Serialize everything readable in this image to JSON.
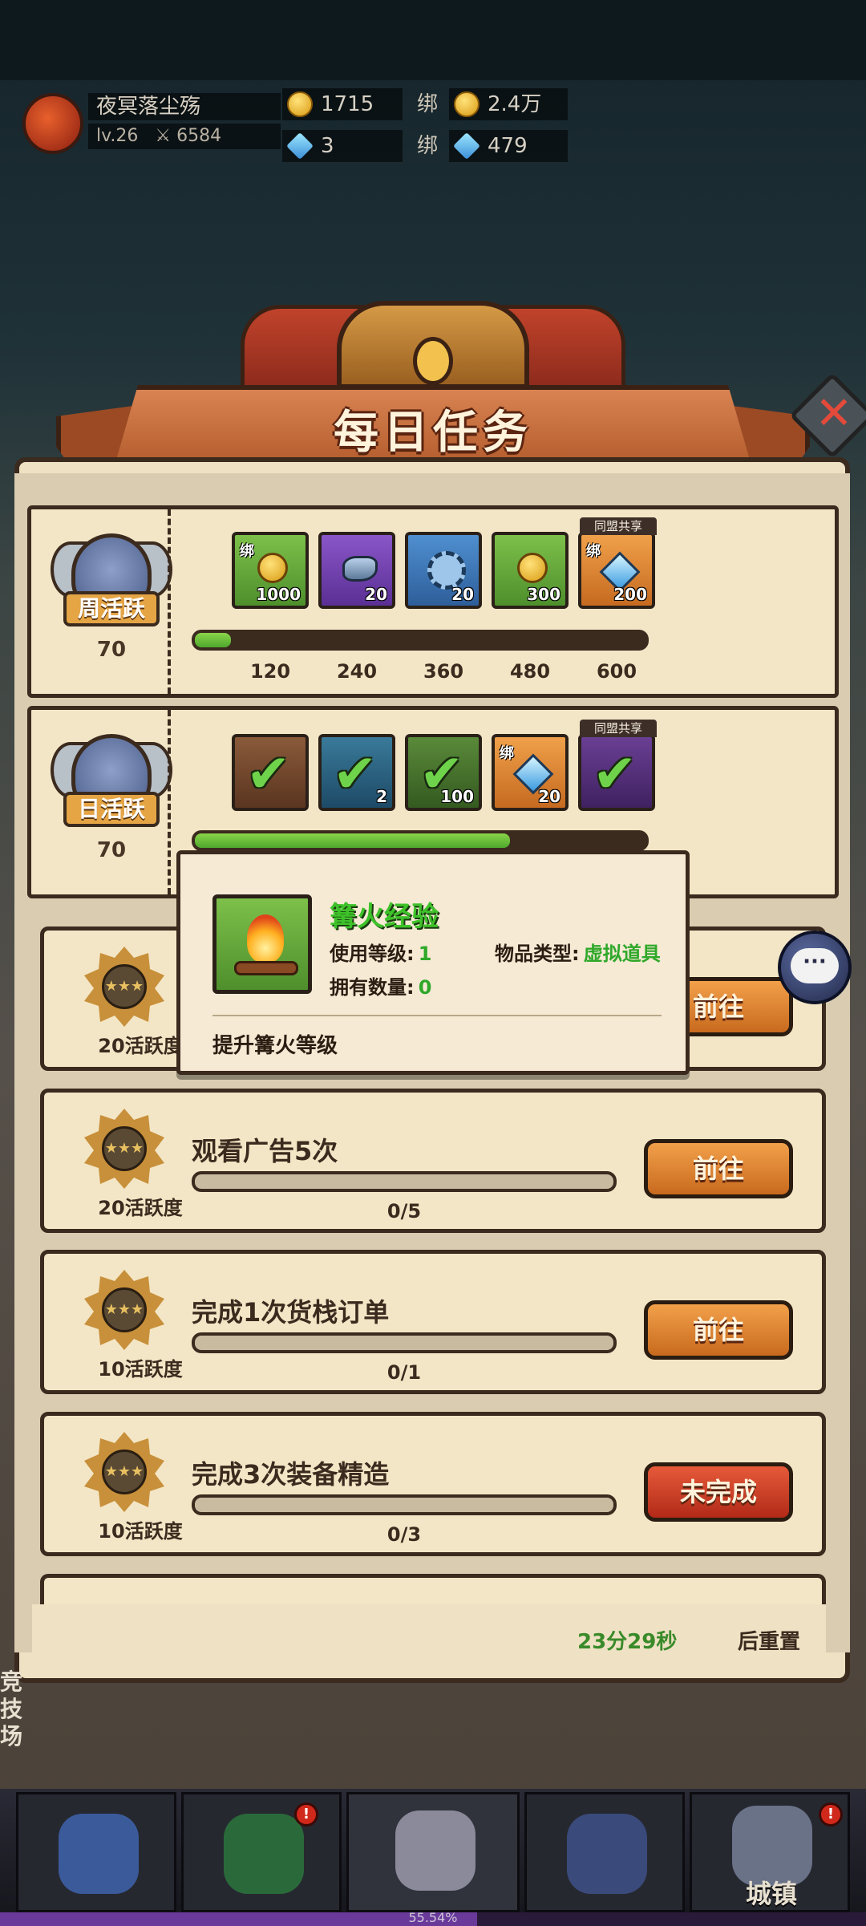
{
  "player": {
    "name": "夜冥落尘殇",
    "level": "lv.26",
    "power": "6584"
  },
  "currency": {
    "coin": "1715",
    "bound_coin": "2.4万",
    "gem": "3",
    "bound_gem": "479",
    "bind_label": "绑"
  },
  "title": "每日任务",
  "weekly": {
    "label": "周活跃",
    "value": "70",
    "progress_fraction": 0.08,
    "milestones": [
      "120",
      "240",
      "360",
      "480",
      "600"
    ],
    "rewards": [
      {
        "icon": "gold-coin-icon",
        "qty": "1000",
        "bind": "绑"
      },
      {
        "icon": "stone-icon",
        "qty": "20"
      },
      {
        "icon": "gear-token-icon",
        "qty": "20"
      },
      {
        "icon": "gold-coin-icon",
        "qty": "300"
      },
      {
        "icon": "diamond-icon",
        "qty": "200",
        "bind": "绑",
        "shared": "同盟共享"
      }
    ]
  },
  "daily": {
    "label": "日活跃",
    "value": "70",
    "progress_fraction": 0.7,
    "rewards": [
      {
        "icon": "check-icon"
      },
      {
        "icon": "check-icon",
        "qty": "2"
      },
      {
        "icon": "check-icon",
        "qty": "100"
      },
      {
        "icon": "diamond-icon",
        "qty": "20",
        "bind": "绑"
      },
      {
        "icon": "check-icon",
        "shared": "同盟共享"
      }
    ]
  },
  "tooltip": {
    "name": "篝火经验",
    "use_level_label": "使用等级:",
    "use_level": "1",
    "owned_label": "拥有数量:",
    "owned": "0",
    "type_label": "物品类型:",
    "type": "虚拟道具",
    "description": "提升篝火等级"
  },
  "tasks": [
    {
      "title": "",
      "points": "20活跃度",
      "progress": "",
      "button": "前往"
    },
    {
      "title": "观看广告5次",
      "points": "20活跃度",
      "progress": "0/5",
      "button": "前往"
    },
    {
      "title": "完成1次货栈订单",
      "points": "10活跃度",
      "progress": "0/1",
      "button": "前往"
    },
    {
      "title": "完成3次装备精造",
      "points": "10活跃度",
      "progress": "0/3",
      "button": "未完成"
    }
  ],
  "reset": {
    "time": "23分29秒",
    "suffix": "后重置"
  },
  "side_label": "竞技场",
  "nav": {
    "town_label": "城镇",
    "badge": "!"
  },
  "exp_text": "55.54%"
}
